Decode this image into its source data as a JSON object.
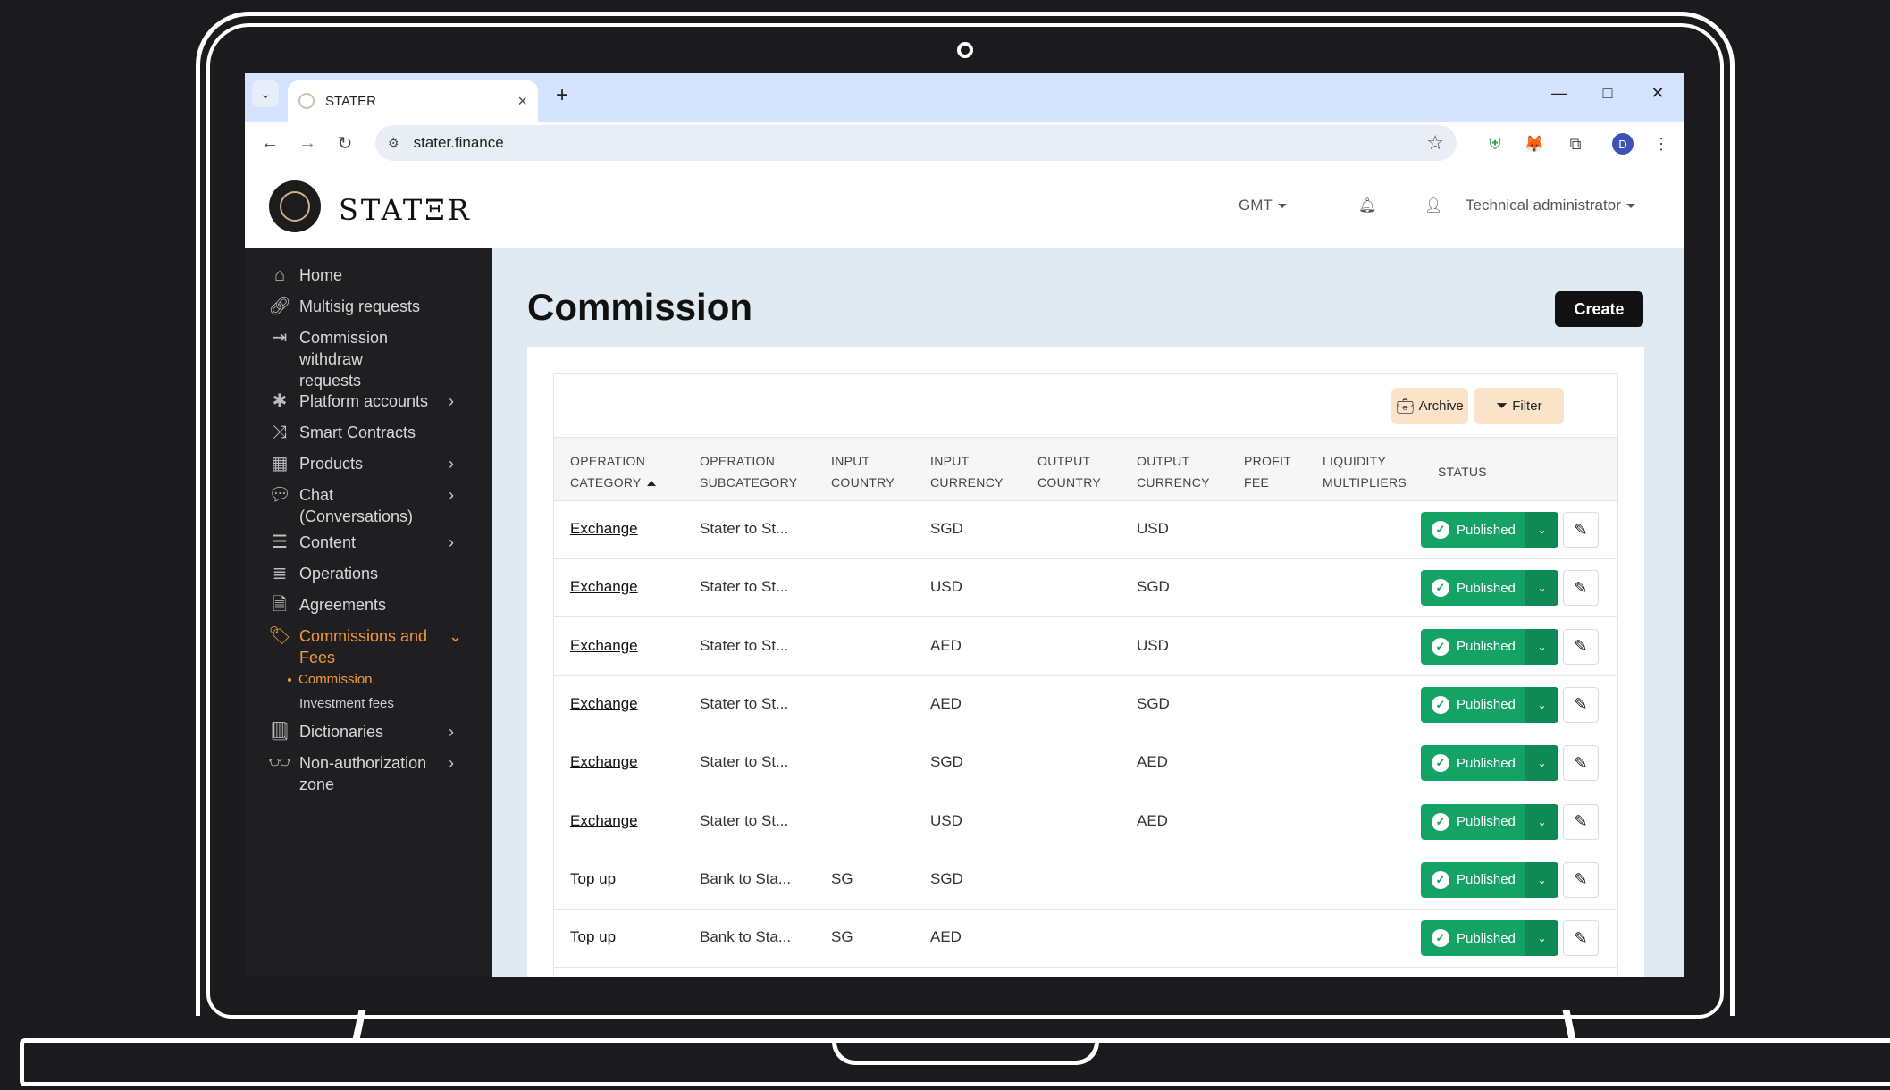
{
  "browser": {
    "tab_title": "STATER",
    "url": "stater.finance",
    "avatar_letter": "D"
  },
  "header": {
    "logo_text": "STATΞR",
    "timezone": "GMT",
    "user": "Technical administrator"
  },
  "sidebar": {
    "items": [
      {
        "label": "Home",
        "icon": "home-icon"
      },
      {
        "label": "Multisig requests",
        "icon": "link-icon"
      },
      {
        "label": "Commission withdraw requests",
        "icon": "sign-out-icon"
      },
      {
        "label": "Platform accounts",
        "icon": "asterisk-icon"
      },
      {
        "label": "Smart Contracts",
        "icon": "shuffle-icon"
      },
      {
        "label": "Products",
        "icon": "grid-icon"
      },
      {
        "label": "Chat (Conversations)",
        "icon": "chat-icon"
      },
      {
        "label": "Content",
        "icon": "server-icon"
      },
      {
        "label": "Operations",
        "icon": "list-icon"
      },
      {
        "label": "Agreements",
        "icon": "file-icon"
      },
      {
        "label": "Commissions and Fees",
        "icon": "tags-icon"
      },
      {
        "label": "Dictionaries",
        "icon": "book-icon"
      },
      {
        "label": "Non-authorization zone",
        "icon": "glasses-icon"
      }
    ],
    "sub_items": [
      "Commission",
      "Investment fees"
    ]
  },
  "main": {
    "title": "Commission",
    "create_label": "Create",
    "archive_label": "Archive",
    "filter_label": "Filter",
    "columns": [
      [
        "OPERATION",
        "CATEGORY"
      ],
      [
        "OPERATION",
        "SUBCATEGORY"
      ],
      [
        "INPUT",
        "COUNTRY"
      ],
      [
        "INPUT",
        "CURRENCY"
      ],
      [
        "OUTPUT",
        "COUNTRY"
      ],
      [
        "OUTPUT",
        "CURRENCY"
      ],
      [
        "PROFIT",
        "FEE"
      ],
      [
        "LIQUIDITY",
        "MULTIPLIERS"
      ],
      [
        "STATUS",
        ""
      ]
    ],
    "rows": [
      {
        "category": "Exchange",
        "subcategory": "Stater to St...",
        "input_country": "",
        "input_currency": "SGD",
        "output_country": "",
        "output_currency": "USD",
        "status": "Published"
      },
      {
        "category": "Exchange",
        "subcategory": "Stater to St...",
        "input_country": "",
        "input_currency": "USD",
        "output_country": "",
        "output_currency": "SGD",
        "status": "Published"
      },
      {
        "category": "Exchange",
        "subcategory": "Stater to St...",
        "input_country": "",
        "input_currency": "AED",
        "output_country": "",
        "output_currency": "USD",
        "status": "Published"
      },
      {
        "category": "Exchange",
        "subcategory": "Stater to St...",
        "input_country": "",
        "input_currency": "AED",
        "output_country": "",
        "output_currency": "SGD",
        "status": "Published"
      },
      {
        "category": "Exchange",
        "subcategory": "Stater to St...",
        "input_country": "",
        "input_currency": "SGD",
        "output_country": "",
        "output_currency": "AED",
        "status": "Published"
      },
      {
        "category": "Exchange",
        "subcategory": "Stater to St...",
        "input_country": "",
        "input_currency": "USD",
        "output_country": "",
        "output_currency": "AED",
        "status": "Published"
      },
      {
        "category": "Top up",
        "subcategory": "Bank to Sta...",
        "input_country": "SG",
        "input_currency": "SGD",
        "output_country": "",
        "output_currency": "",
        "status": "Published"
      },
      {
        "category": "Top up",
        "subcategory": "Bank to Sta...",
        "input_country": "SG",
        "input_currency": "AED",
        "output_country": "",
        "output_currency": "",
        "status": "Published"
      }
    ]
  },
  "colors": {
    "accent": "#f59a3c",
    "published": "#14a365",
    "sidebar_bg": "#1f1f21",
    "main_bg": "#dfeaf1"
  }
}
